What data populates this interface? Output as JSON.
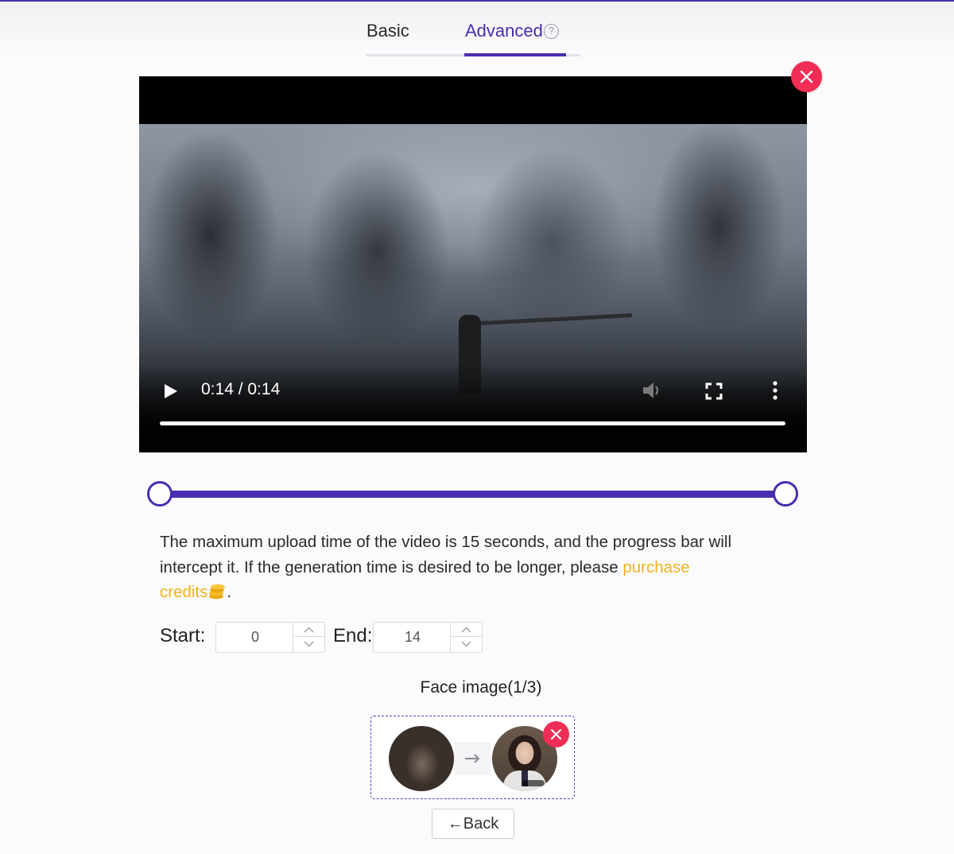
{
  "tabs": {
    "basic": "Basic",
    "advanced": "Advanced",
    "help": "?"
  },
  "video": {
    "time": "0:14 / 0:14",
    "progress": 1.0
  },
  "trim": {
    "start_fraction": 0,
    "end_fraction": 1
  },
  "info": {
    "text": "The maximum upload time of the video is 15 seconds, and the progress bar will intercept it. If the generation time is desired to be longer, please ",
    "link1": "purchase",
    "link2": "credits",
    "end": "."
  },
  "fields": {
    "start_label": "Start:",
    "start_value": "0",
    "end_label": "End:",
    "end_value": "14"
  },
  "face": {
    "title": "Face image(1/3)"
  },
  "back_label": "←Back",
  "colors": {
    "accent": "#4a2db0",
    "close": "#ef2d55",
    "link": "#f2b21a"
  },
  "icons": [
    "help-icon",
    "play-icon",
    "volume-icon",
    "fullscreen-icon",
    "more-icon",
    "close-icon",
    "coin-icon",
    "chevron-up-icon",
    "chevron-down-icon",
    "arrow-right-icon"
  ]
}
